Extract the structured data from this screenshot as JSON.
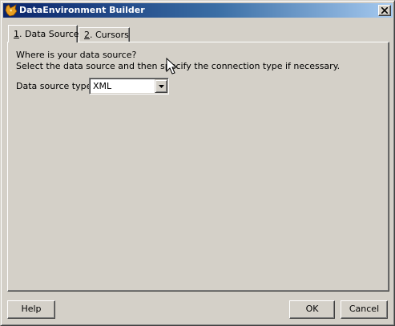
{
  "window": {
    "title": "DataEnvironment Builder",
    "icon": "fox-icon",
    "titlebar_colors": [
      "#0a246a",
      "#a6caf0"
    ]
  },
  "tabs": [
    {
      "accelerator": "1",
      "rest": ". Data Source",
      "active": true
    },
    {
      "accelerator": "2",
      "rest": ". Cursors",
      "active": false
    }
  ],
  "panel": {
    "question": "Where is your data source?",
    "instruction": "Select the data source and then specify the connection type if necessary.",
    "data_source_type": {
      "label": "Data source type",
      "value": "XML"
    }
  },
  "buttons": {
    "help": "Help",
    "ok": "OK",
    "cancel": "Cancel"
  }
}
